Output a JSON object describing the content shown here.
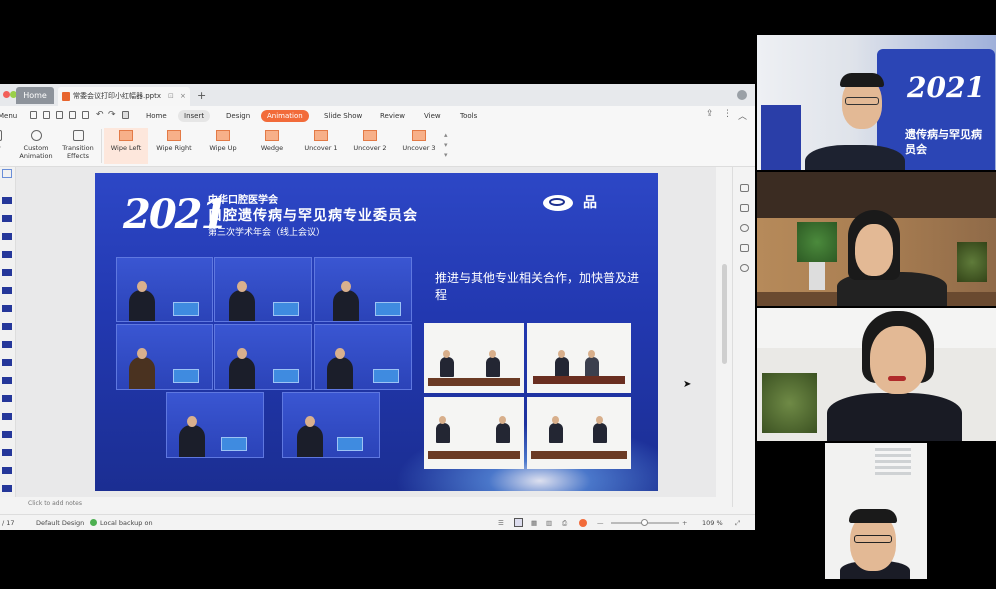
{
  "app": {
    "tabs": {
      "home_label": "Home",
      "file_label": "常委会议打印小红幅器.pptx",
      "new_tab_symbol": "+"
    },
    "menu": {
      "left_label": "Menu",
      "items": [
        "Home",
        "Insert",
        "Design",
        "Animation",
        "Slide Show",
        "Review",
        "View",
        "Tools"
      ],
      "active": "Animation"
    },
    "ribbon": {
      "preview_label": "ew",
      "custom_animation": "Custom\nAnimation",
      "transition_effects": "Transition\nEffects",
      "effects": [
        "Wipe Left",
        "Wipe Right",
        "Wipe Up",
        "Wedge",
        "Uncover 1",
        "Uncover 2",
        "Uncover 3"
      ]
    },
    "notes_placeholder": "Click to add notes",
    "status": {
      "page": "/ 17",
      "theme": "Default Design",
      "backup": "Local backup on",
      "zoom": "109 %",
      "zoom_fraction": 0.48
    }
  },
  "slide": {
    "year": "2021",
    "org": "中华口腔医学会",
    "committee": "口腔遗传病与罕见病专业委员会",
    "conference": "第三次学术年会（线上会议）",
    "headline": "推进与其他专业相关合作，加快普及进程",
    "logo_text": "品"
  },
  "participants": [
    {
      "name": "participant-1",
      "background_text": "2021"
    },
    {
      "name": "participant-2"
    },
    {
      "name": "participant-3"
    },
    {
      "name": "participant-4"
    }
  ],
  "colors": {
    "accent": "#f26b3a",
    "slide_blue": "#2238b0",
    "backdrop_text": "遗传病与罕见病\n员会"
  }
}
